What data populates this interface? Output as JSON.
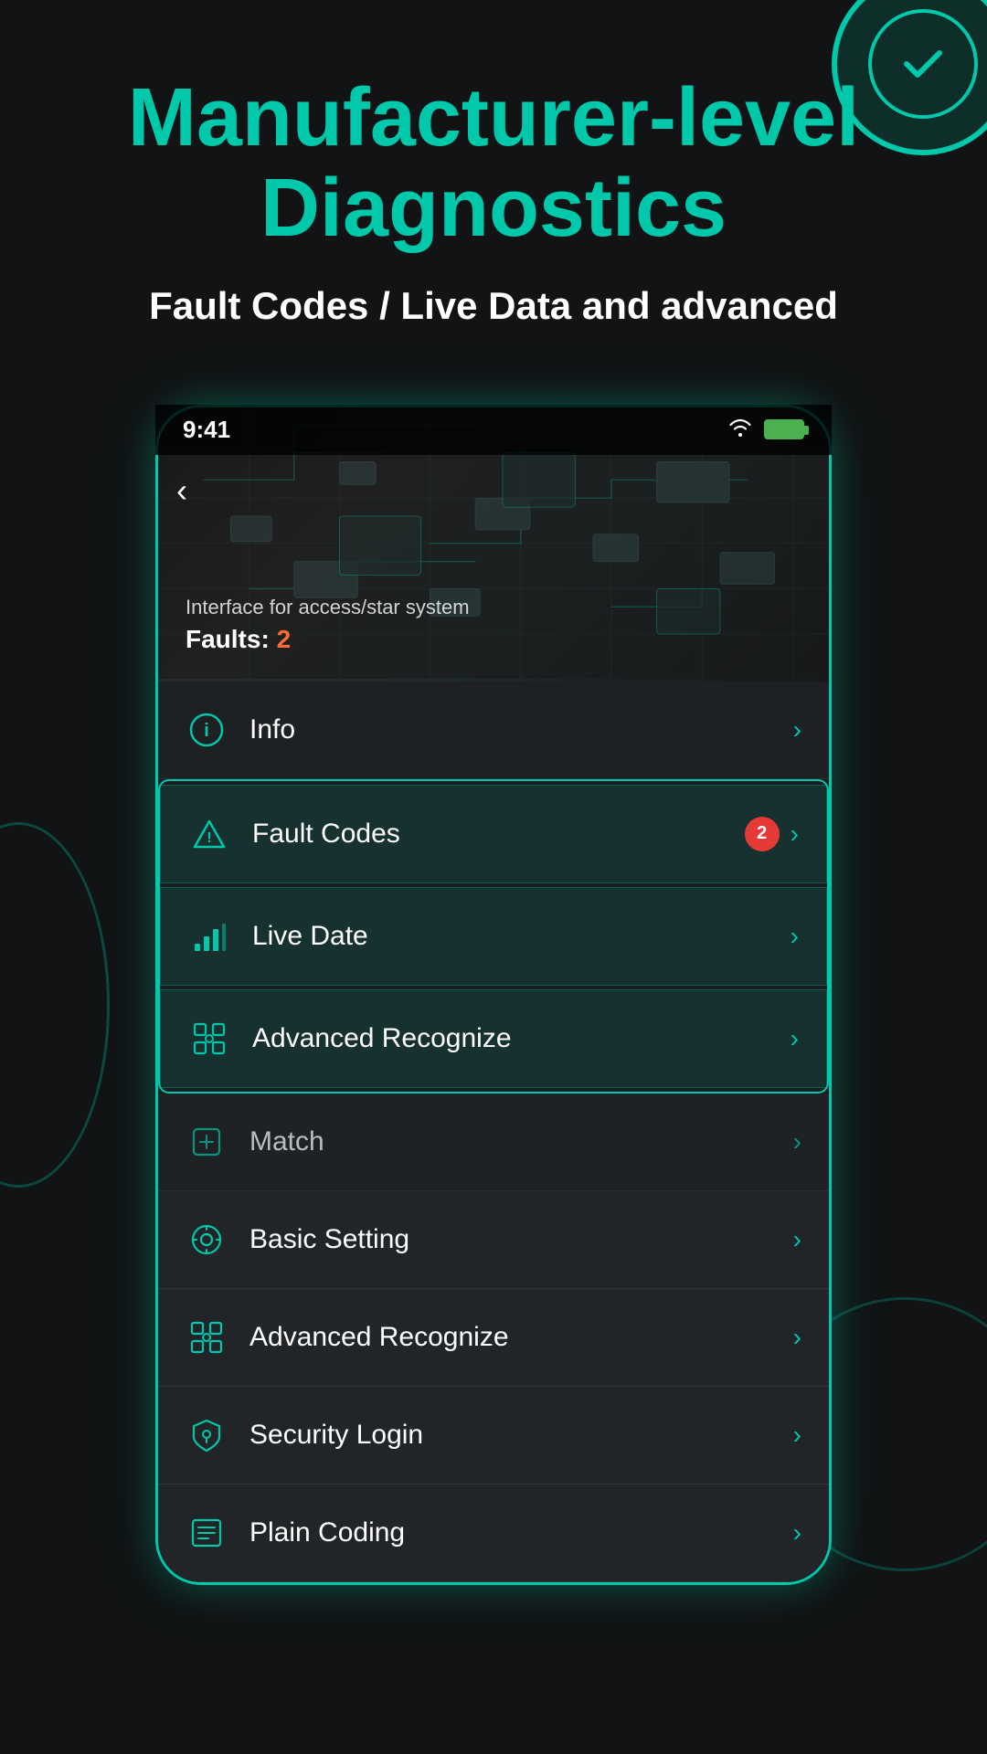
{
  "header": {
    "title_line1": "Manufacturer-level",
    "title_line2": "Diagnostics",
    "subtitle": "Fault Codes / Live Data and advanced"
  },
  "phone": {
    "status_bar": {
      "time": "9:41"
    },
    "circuit_area": {
      "subtitle": "Interface for access/star system",
      "faults_label": "Faults: ",
      "faults_count": "2"
    },
    "menu_items": [
      {
        "id": "info",
        "label": "Info",
        "icon": "info",
        "badge": null,
        "highlighted": false
      },
      {
        "id": "fault-codes",
        "label": "Fault Codes",
        "icon": "alert",
        "badge": "2",
        "highlighted": true
      },
      {
        "id": "live-date",
        "label": "Live Date",
        "icon": "bar-chart",
        "badge": null,
        "highlighted": true
      },
      {
        "id": "advanced-recognize-top",
        "label": "Advanced Recognize",
        "icon": "scan",
        "badge": null,
        "highlighted": true
      },
      {
        "id": "match",
        "label": "Match",
        "icon": "match",
        "badge": null,
        "highlighted": false
      },
      {
        "id": "basic-setting",
        "label": "Basic Setting",
        "icon": "gear-hex",
        "badge": null,
        "highlighted": false
      },
      {
        "id": "advanced-recognize",
        "label": "Advanced Recognize",
        "icon": "scan",
        "badge": null,
        "highlighted": false
      },
      {
        "id": "security-login",
        "label": "Security Login",
        "icon": "shield",
        "badge": null,
        "highlighted": false
      },
      {
        "id": "plain-coding",
        "label": "Plain Coding",
        "icon": "list",
        "badge": null,
        "highlighted": false
      }
    ]
  },
  "colors": {
    "teal": "#00c8aa",
    "orange": "#ff6b35",
    "red": "#e53935",
    "bg_dark": "#111314",
    "card_bg": "#222527"
  }
}
